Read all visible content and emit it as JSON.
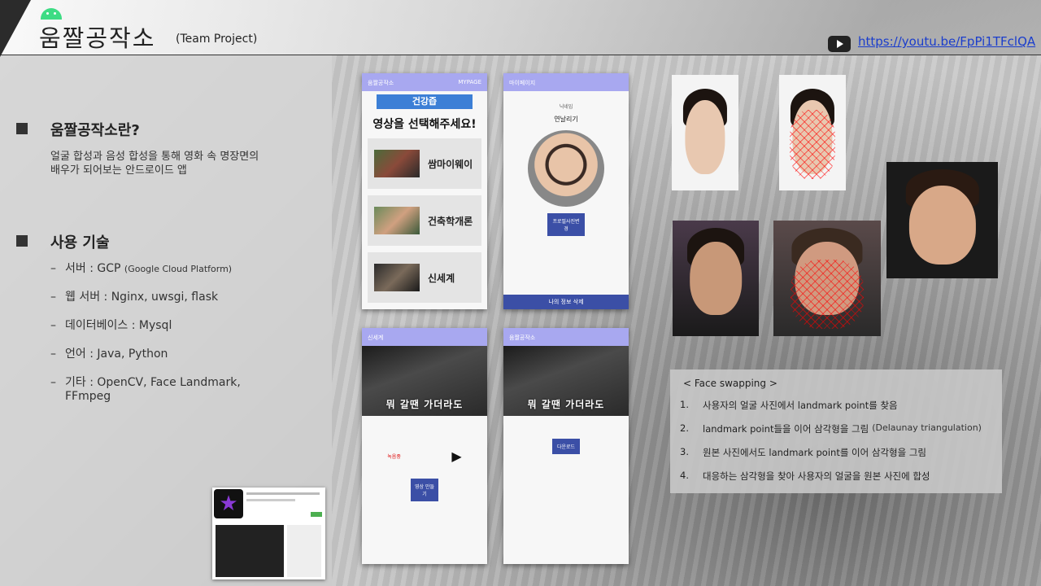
{
  "header": {
    "title": "움짤공작소",
    "subtitle": "(Team Project)",
    "youtube_link": "https://youtu.be/FpPi1TFclQA"
  },
  "intro": {
    "heading": "움짤공작소란?",
    "description": "얼굴 합성과 음성 합성을 통해 영화 속 명장면의 배우가 되어보는 안드로이드 앱"
  },
  "tech": {
    "heading": "사용 기술",
    "items": [
      {
        "text": "서버 : GCP ",
        "note": "(Google Cloud Platform)"
      },
      {
        "text": "웹 서버 : Nginx, uwsgi, flask",
        "note": ""
      },
      {
        "text": "데이터베이스 : Mysql",
        "note": ""
      },
      {
        "text": "언어 : Java, Python",
        "note": ""
      },
      {
        "text": "기타 : OpenCV, Face Landmark, FFmpeg",
        "note": ""
      }
    ]
  },
  "phone1": {
    "app_name": "움짤공작소",
    "nav_right": "MYPAGE",
    "banner": "건강즙",
    "heading": "영상을 선택해주세요!",
    "videos": [
      "쌈마이웨이",
      "건축학개론",
      "신세계"
    ]
  },
  "phone2": {
    "title": "마이페이지",
    "nickname_label": "닉네임",
    "nickname": "연날리기",
    "photo_button": "프로필사진변경",
    "delete_button": "나의 정보 삭제"
  },
  "phone3": {
    "title": "신세계",
    "caption": "뭐 갈땐 가더라도",
    "record_label": "녹음중",
    "make_button": "영상 만들기"
  },
  "phone4": {
    "title": "움짤공작소",
    "caption": "뭐 갈땐 가더라도",
    "download_button": "다운로드"
  },
  "face_swap": {
    "title": "< Face swapping >",
    "steps": [
      {
        "num": "1.",
        "text": "사용자의 얼굴 사진에서 landmark point를 찾음",
        "note": ""
      },
      {
        "num": "2.",
        "text": "landmark point들을 이어 삼각형을 그림",
        "note": "(Delaunay triangulation)"
      },
      {
        "num": "3.",
        "text": "원본 사진에서도 landmark point를 이어 삼각형을 그림",
        "note": ""
      },
      {
        "num": "4.",
        "text": "대응하는 삼각형을 찾아 사용자의 얼굴을 원본 사진에 합성",
        "note": ""
      }
    ]
  },
  "colors": {
    "accent": "#a8a8f0",
    "button": "#3b4fa6",
    "android": "#3ddc84"
  }
}
